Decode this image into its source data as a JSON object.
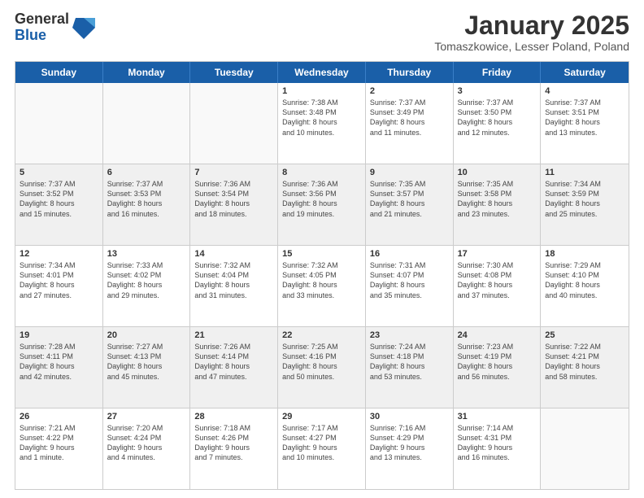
{
  "logo": {
    "general": "General",
    "blue": "Blue"
  },
  "title": "January 2025",
  "subtitle": "Tomaszkowice, Lesser Poland, Poland",
  "days": [
    "Sunday",
    "Monday",
    "Tuesday",
    "Wednesday",
    "Thursday",
    "Friday",
    "Saturday"
  ],
  "weeks": [
    [
      {
        "day": "",
        "info": "",
        "empty": true
      },
      {
        "day": "",
        "info": "",
        "empty": true
      },
      {
        "day": "",
        "info": "",
        "empty": true
      },
      {
        "day": "1",
        "info": "Sunrise: 7:38 AM\nSunset: 3:48 PM\nDaylight: 8 hours\nand 10 minutes.",
        "empty": false
      },
      {
        "day": "2",
        "info": "Sunrise: 7:37 AM\nSunset: 3:49 PM\nDaylight: 8 hours\nand 11 minutes.",
        "empty": false
      },
      {
        "day": "3",
        "info": "Sunrise: 7:37 AM\nSunset: 3:50 PM\nDaylight: 8 hours\nand 12 minutes.",
        "empty": false
      },
      {
        "day": "4",
        "info": "Sunrise: 7:37 AM\nSunset: 3:51 PM\nDaylight: 8 hours\nand 13 minutes.",
        "empty": false
      }
    ],
    [
      {
        "day": "5",
        "info": "Sunrise: 7:37 AM\nSunset: 3:52 PM\nDaylight: 8 hours\nand 15 minutes.",
        "empty": false
      },
      {
        "day": "6",
        "info": "Sunrise: 7:37 AM\nSunset: 3:53 PM\nDaylight: 8 hours\nand 16 minutes.",
        "empty": false
      },
      {
        "day": "7",
        "info": "Sunrise: 7:36 AM\nSunset: 3:54 PM\nDaylight: 8 hours\nand 18 minutes.",
        "empty": false
      },
      {
        "day": "8",
        "info": "Sunrise: 7:36 AM\nSunset: 3:56 PM\nDaylight: 8 hours\nand 19 minutes.",
        "empty": false
      },
      {
        "day": "9",
        "info": "Sunrise: 7:35 AM\nSunset: 3:57 PM\nDaylight: 8 hours\nand 21 minutes.",
        "empty": false
      },
      {
        "day": "10",
        "info": "Sunrise: 7:35 AM\nSunset: 3:58 PM\nDaylight: 8 hours\nand 23 minutes.",
        "empty": false
      },
      {
        "day": "11",
        "info": "Sunrise: 7:34 AM\nSunset: 3:59 PM\nDaylight: 8 hours\nand 25 minutes.",
        "empty": false
      }
    ],
    [
      {
        "day": "12",
        "info": "Sunrise: 7:34 AM\nSunset: 4:01 PM\nDaylight: 8 hours\nand 27 minutes.",
        "empty": false
      },
      {
        "day": "13",
        "info": "Sunrise: 7:33 AM\nSunset: 4:02 PM\nDaylight: 8 hours\nand 29 minutes.",
        "empty": false
      },
      {
        "day": "14",
        "info": "Sunrise: 7:32 AM\nSunset: 4:04 PM\nDaylight: 8 hours\nand 31 minutes.",
        "empty": false
      },
      {
        "day": "15",
        "info": "Sunrise: 7:32 AM\nSunset: 4:05 PM\nDaylight: 8 hours\nand 33 minutes.",
        "empty": false
      },
      {
        "day": "16",
        "info": "Sunrise: 7:31 AM\nSunset: 4:07 PM\nDaylight: 8 hours\nand 35 minutes.",
        "empty": false
      },
      {
        "day": "17",
        "info": "Sunrise: 7:30 AM\nSunset: 4:08 PM\nDaylight: 8 hours\nand 37 minutes.",
        "empty": false
      },
      {
        "day": "18",
        "info": "Sunrise: 7:29 AM\nSunset: 4:10 PM\nDaylight: 8 hours\nand 40 minutes.",
        "empty": false
      }
    ],
    [
      {
        "day": "19",
        "info": "Sunrise: 7:28 AM\nSunset: 4:11 PM\nDaylight: 8 hours\nand 42 minutes.",
        "empty": false
      },
      {
        "day": "20",
        "info": "Sunrise: 7:27 AM\nSunset: 4:13 PM\nDaylight: 8 hours\nand 45 minutes.",
        "empty": false
      },
      {
        "day": "21",
        "info": "Sunrise: 7:26 AM\nSunset: 4:14 PM\nDaylight: 8 hours\nand 47 minutes.",
        "empty": false
      },
      {
        "day": "22",
        "info": "Sunrise: 7:25 AM\nSunset: 4:16 PM\nDaylight: 8 hours\nand 50 minutes.",
        "empty": false
      },
      {
        "day": "23",
        "info": "Sunrise: 7:24 AM\nSunset: 4:18 PM\nDaylight: 8 hours\nand 53 minutes.",
        "empty": false
      },
      {
        "day": "24",
        "info": "Sunrise: 7:23 AM\nSunset: 4:19 PM\nDaylight: 8 hours\nand 56 minutes.",
        "empty": false
      },
      {
        "day": "25",
        "info": "Sunrise: 7:22 AM\nSunset: 4:21 PM\nDaylight: 8 hours\nand 58 minutes.",
        "empty": false
      }
    ],
    [
      {
        "day": "26",
        "info": "Sunrise: 7:21 AM\nSunset: 4:22 PM\nDaylight: 9 hours\nand 1 minute.",
        "empty": false
      },
      {
        "day": "27",
        "info": "Sunrise: 7:20 AM\nSunset: 4:24 PM\nDaylight: 9 hours\nand 4 minutes.",
        "empty": false
      },
      {
        "day": "28",
        "info": "Sunrise: 7:18 AM\nSunset: 4:26 PM\nDaylight: 9 hours\nand 7 minutes.",
        "empty": false
      },
      {
        "day": "29",
        "info": "Sunrise: 7:17 AM\nSunset: 4:27 PM\nDaylight: 9 hours\nand 10 minutes.",
        "empty": false
      },
      {
        "day": "30",
        "info": "Sunrise: 7:16 AM\nSunset: 4:29 PM\nDaylight: 9 hours\nand 13 minutes.",
        "empty": false
      },
      {
        "day": "31",
        "info": "Sunrise: 7:14 AM\nSunset: 4:31 PM\nDaylight: 9 hours\nand 16 minutes.",
        "empty": false
      },
      {
        "day": "",
        "info": "",
        "empty": true
      }
    ]
  ]
}
